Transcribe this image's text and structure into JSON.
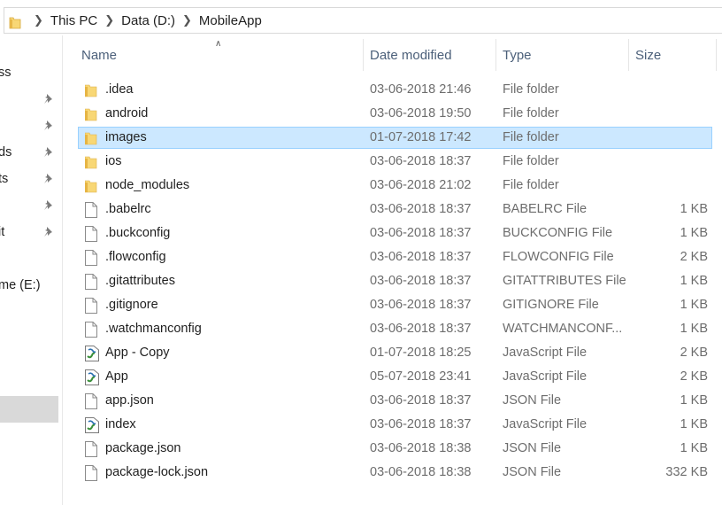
{
  "breadcrumb": [
    "This PC",
    "Data (D:)",
    "MobileApp"
  ],
  "nav": {
    "items": [
      {
        "label": "ss",
        "pinned": false
      },
      {
        "label": "",
        "pinned": true
      },
      {
        "label": "",
        "pinned": true
      },
      {
        "label": "ds",
        "pinned": true
      },
      {
        "label": "ts",
        "pinned": true
      },
      {
        "label": "",
        "pinned": true
      },
      {
        "label": "it",
        "pinned": true
      },
      {
        "label": "me (E:)",
        "pinned": false
      }
    ]
  },
  "columns": {
    "name": "Name",
    "date": "Date modified",
    "type": "Type",
    "size": "Size"
  },
  "files": [
    {
      "name": ".idea",
      "date": "03-06-2018 21:46",
      "type": "File folder",
      "size": "",
      "icon": "folder-icon"
    },
    {
      "name": "android",
      "date": "03-06-2018 19:50",
      "type": "File folder",
      "size": "",
      "icon": "folder-icon"
    },
    {
      "name": "images",
      "date": "01-07-2018 17:42",
      "type": "File folder",
      "size": "",
      "icon": "folder-icon",
      "selected": true
    },
    {
      "name": "ios",
      "date": "03-06-2018 18:37",
      "type": "File folder",
      "size": "",
      "icon": "folder-icon"
    },
    {
      "name": "node_modules",
      "date": "03-06-2018 21:02",
      "type": "File folder",
      "size": "",
      "icon": "folder-icon"
    },
    {
      "name": ".babelrc",
      "date": "03-06-2018 18:37",
      "type": "BABELRC File",
      "size": "1 KB",
      "icon": "file-icon"
    },
    {
      "name": ".buckconfig",
      "date": "03-06-2018 18:37",
      "type": "BUCKCONFIG File",
      "size": "1 KB",
      "icon": "file-icon"
    },
    {
      "name": ".flowconfig",
      "date": "03-06-2018 18:37",
      "type": "FLOWCONFIG File",
      "size": "2 KB",
      "icon": "file-icon"
    },
    {
      "name": ".gitattributes",
      "date": "03-06-2018 18:37",
      "type": "GITATTRIBUTES File",
      "size": "1 KB",
      "icon": "file-icon"
    },
    {
      "name": ".gitignore",
      "date": "03-06-2018 18:37",
      "type": "GITIGNORE File",
      "size": "1 KB",
      "icon": "file-icon"
    },
    {
      "name": ".watchmanconfig",
      "date": "03-06-2018 18:37",
      "type": "WATCHMANCONF...",
      "size": "1 KB",
      "icon": "file-icon"
    },
    {
      "name": "App - Copy",
      "date": "01-07-2018 18:25",
      "type": "JavaScript File",
      "size": "2 KB",
      "icon": "js-file-icon"
    },
    {
      "name": "App",
      "date": "05-07-2018 23:41",
      "type": "JavaScript File",
      "size": "2 KB",
      "icon": "js-file-icon"
    },
    {
      "name": "app.json",
      "date": "03-06-2018 18:37",
      "type": "JSON File",
      "size": "1 KB",
      "icon": "file-icon"
    },
    {
      "name": "index",
      "date": "03-06-2018 18:37",
      "type": "JavaScript File",
      "size": "1 KB",
      "icon": "js-file-icon"
    },
    {
      "name": "package.json",
      "date": "03-06-2018 18:38",
      "type": "JSON File",
      "size": "1 KB",
      "icon": "file-icon"
    },
    {
      "name": "package-lock.json",
      "date": "03-06-2018 18:38",
      "type": "JSON File",
      "size": "332 KB",
      "icon": "file-icon"
    }
  ],
  "colors": {
    "selection": "#cce8ff",
    "selection_border": "#99d1ff",
    "header_text": "#4c607a",
    "folder": "#f8d775"
  }
}
